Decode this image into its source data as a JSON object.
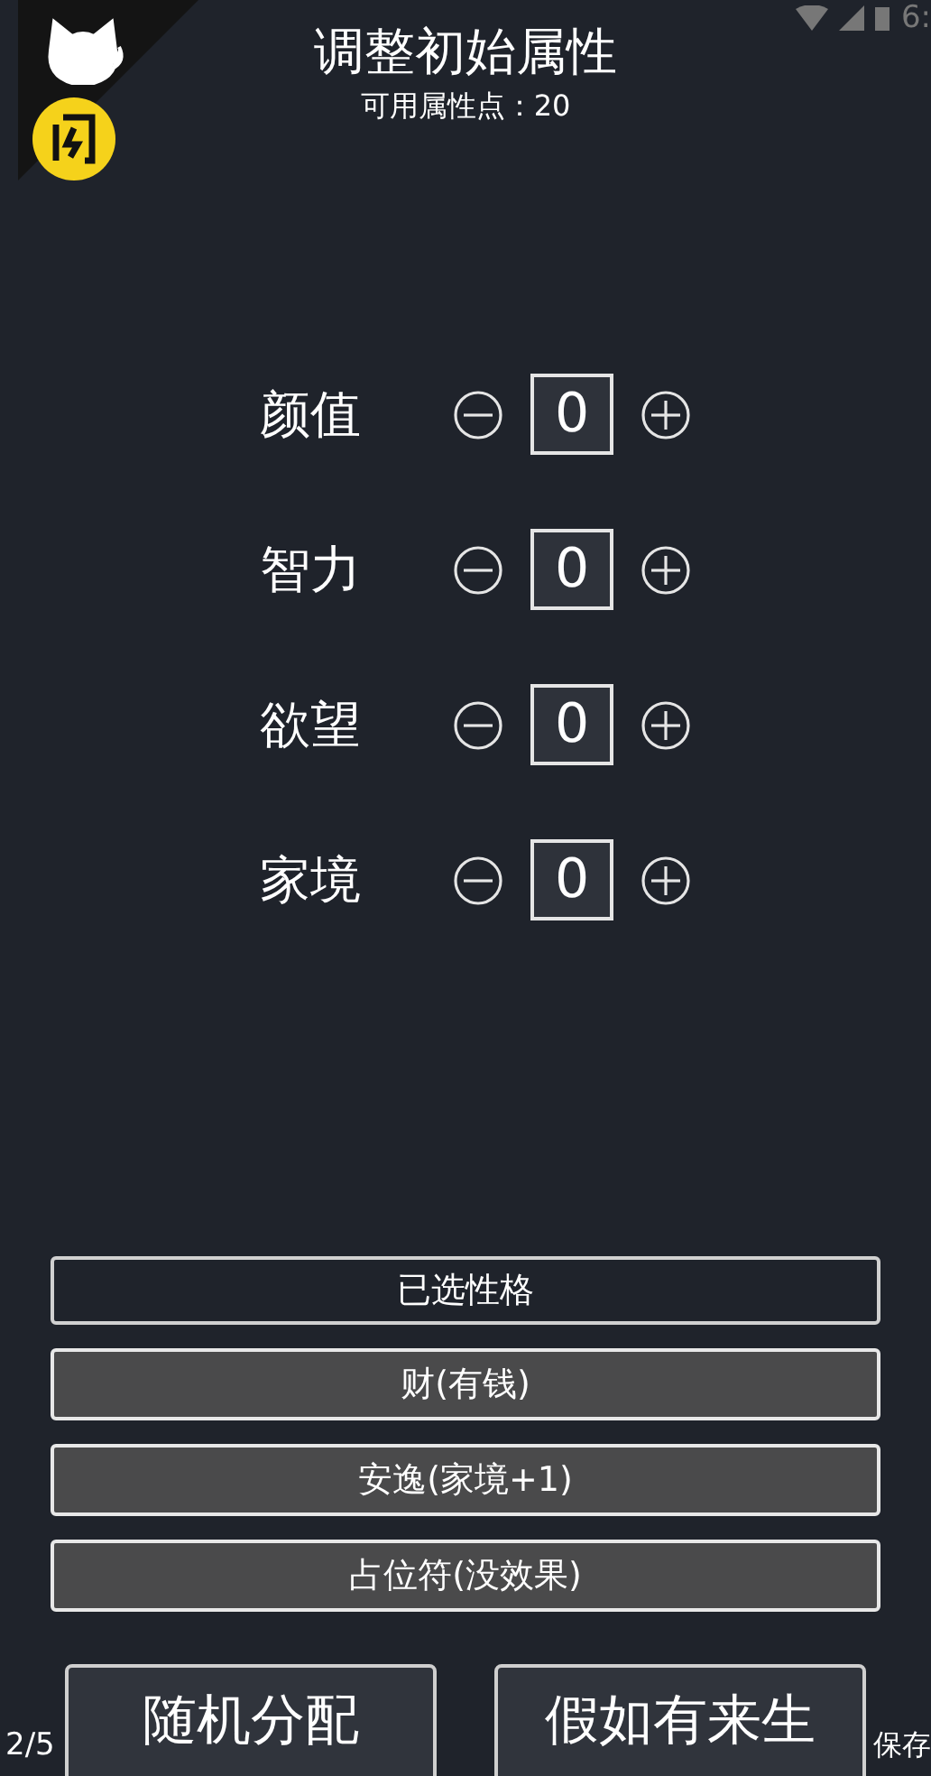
{
  "status_bar": {
    "time": "6:"
  },
  "header": {
    "title": "调整初始属性",
    "points": "可用属性点：20"
  },
  "attributes": [
    {
      "name": "颜值",
      "value": "0"
    },
    {
      "name": "智力",
      "value": "0"
    },
    {
      "name": "欲望",
      "value": "0"
    },
    {
      "name": "家境",
      "value": "0"
    }
  ],
  "traits": [
    {
      "kind": "header",
      "label": "已选性格"
    },
    {
      "kind": "trait",
      "label": "财(有钱)"
    },
    {
      "kind": "trait",
      "label": "安逸(家境+1)"
    },
    {
      "kind": "trait",
      "label": "占位符(没效果)"
    }
  ],
  "actions": [
    "随机分配",
    "假如有来生"
  ],
  "page_indicator": "2/5",
  "save": "保存"
}
